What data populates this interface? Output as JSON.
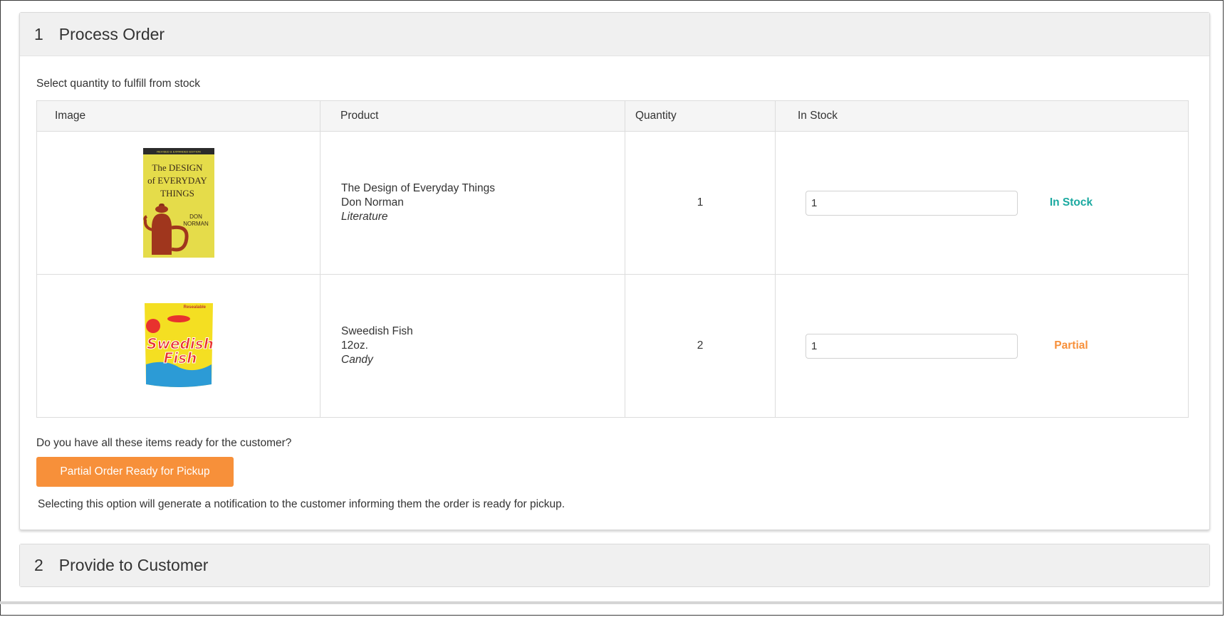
{
  "step1": {
    "number": "1",
    "title": "Process Order",
    "instruction": "Select quantity to fulfill from stock",
    "columns": [
      "Image",
      "Product",
      "Quantity",
      "In Stock"
    ],
    "items": [
      {
        "name": "The Design of Everyday Things",
        "detail": "Don Norman",
        "category": "Literature",
        "quantity": "1",
        "fulfill_value": "1",
        "status": "In Stock",
        "status_color": "#1aa9a0",
        "image": "book-cover",
        "cover_lines": [
          "REVISED & EXPANDED EDITION",
          "The DESIGN",
          "of EVERYDAY",
          "THINGS",
          "DON",
          "NORMAN"
        ]
      },
      {
        "name": "Sweedish Fish",
        "detail": "12oz.",
        "category": "Candy",
        "quantity": "2",
        "fulfill_value": "1",
        "status": "Partial",
        "status_color": "#f7903a",
        "image": "candy-bag",
        "bag_lines": [
          "Resealable",
          "Swedish",
          "Fish"
        ]
      }
    ],
    "question": "Do you have all these items ready for the customer?",
    "button_label": "Partial Order Ready for Pickup",
    "button_color": "#f7903a",
    "note": "Selecting this option will generate a notification to the customer informing them the order is ready for pickup."
  },
  "step2": {
    "number": "2",
    "title": "Provide to Customer"
  }
}
